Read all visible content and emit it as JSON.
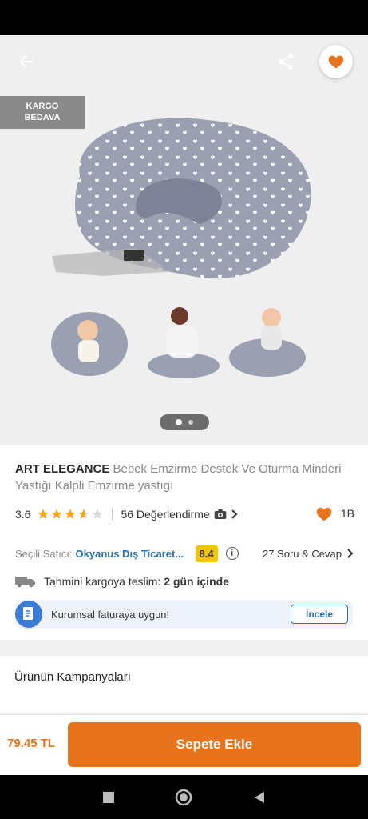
{
  "hero": {
    "cargo_badge_line1": "KARGO",
    "cargo_badge_line2": "BEDAVA",
    "pager_total": 2,
    "pager_active": 1
  },
  "product": {
    "brand": "ART ELEGANCE",
    "name": "Bebek Emzirme Destek Ve Oturma Minderi Yastığı Kalpli Emzirme yastıgı",
    "rating": "3.6",
    "rating_stars": 3.6,
    "reviews_label": "56 Değerlendirme",
    "likes": "1B"
  },
  "seller": {
    "label": "Seçili Satıcı:",
    "name": "Okyanus Dış Ticaret...",
    "score": "8.4",
    "qa_label": "27 Soru & Cevap"
  },
  "shipping": {
    "label": "Tahmini kargoya teslim:",
    "value": "2 gün içinde"
  },
  "invoice": {
    "text": "Kurumsal faturaya uygun!",
    "button": "İncele"
  },
  "campaign": {
    "title": "Ürünün Kampanyaları"
  },
  "bottom": {
    "price": "79.45 TL",
    "add_to_cart": "Sepete Ekle"
  },
  "colors": {
    "accent": "#e8731d",
    "link": "#2a6fb4",
    "score": "#f5c400",
    "star": "#f5a623"
  },
  "icons": {
    "back": "arrow-left-icon",
    "share": "share-icon",
    "favorite": "heart-icon",
    "truck": "truck-icon",
    "invoice": "document-icon",
    "info": "info-icon"
  }
}
